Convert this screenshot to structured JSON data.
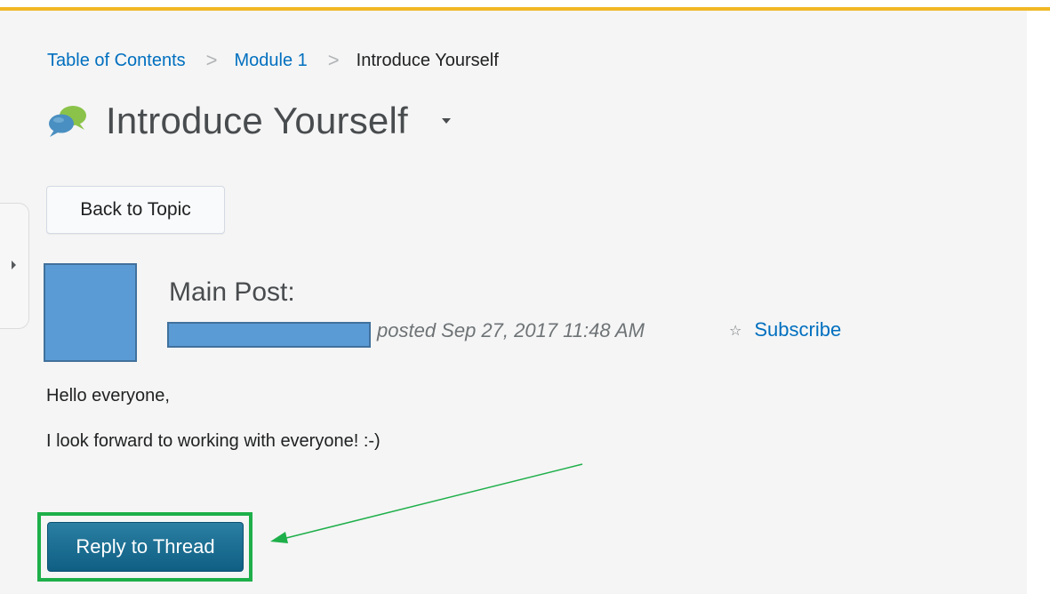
{
  "colors": {
    "accent_bar": "#f1b825",
    "link": "#006fbf",
    "redaction": "#5b9bd5",
    "primary_button": "#1a6e91",
    "highlight": "#1eaf4a"
  },
  "breadcrumb": {
    "items": [
      "Table of Contents",
      "Module 1"
    ],
    "current": "Introduce Yourself",
    "separator": ">"
  },
  "page": {
    "title": "Introduce Yourself",
    "title_icon": "discussion-bubbles-icon",
    "title_menu_icon": "chevron-down-icon"
  },
  "toolbar": {
    "back_label": "Back to Topic"
  },
  "post": {
    "heading": "Main Post:",
    "meta": "posted Sep 27, 2017 11:48 AM",
    "subscribe_icon": "star-icon",
    "subscribe_label": "Subscribe",
    "body": [
      "Hello everyone,",
      "I look forward to working with everyone! :-)"
    ]
  },
  "actions": {
    "reply_label": "Reply to Thread"
  },
  "side_panel": {
    "toggle_icon": "caret-right-icon"
  }
}
